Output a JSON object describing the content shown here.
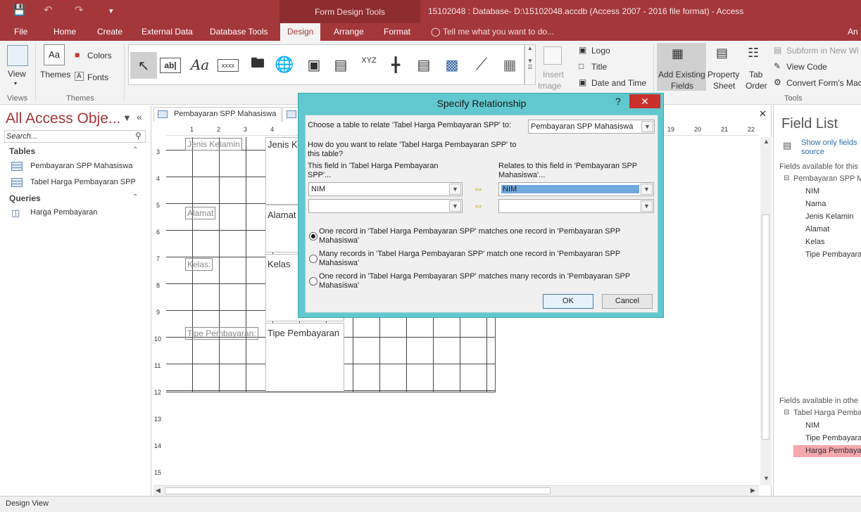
{
  "window": {
    "title": "15102048 : Database- D:\\15102048.accdb (Access 2007 - 2016 file format) - Access",
    "contextual_group": "Form Design Tools",
    "user_initials": "An"
  },
  "ribbon_tabs": [
    "File",
    "Home",
    "Create",
    "External Data",
    "Database Tools",
    "Design",
    "Arrange",
    "Format"
  ],
  "active_tab": "Design",
  "tell_me": "Tell me what you want to do...",
  "ribbon": {
    "views": {
      "view_label": "View",
      "group": "Views"
    },
    "themes": {
      "themes_label": "Themes",
      "colors_label": "Colors",
      "fonts_label": "Fonts",
      "group": "Themes"
    },
    "controls": [
      "ab|",
      "Aa",
      "xxxx",
      "XYZ"
    ],
    "header_footer": {
      "logo": "Logo",
      "title": "Title",
      "date_time": "Date and Time",
      "insert_image_1": "Insert",
      "insert_image_2": "Image"
    },
    "tools": {
      "add_existing_1": "Add Existing",
      "add_existing_2": "Fields",
      "property_1": "Property",
      "property_2": "Sheet",
      "tab_order_1": "Tab",
      "tab_order_2": "Order",
      "subform": "Subform in New Wi",
      "view_code": "View Code",
      "convert": "Convert Form's Mac",
      "group": "Tools"
    }
  },
  "nav_pane": {
    "title": "All Access Obje...",
    "search_placeholder": "Search...",
    "sections": [
      {
        "name": "Tables",
        "items": [
          "Pembayaran SPP Mahasiswa",
          "Tabel Harga Pembayaran SPP"
        ]
      },
      {
        "name": "Queries",
        "items": [
          "Harga Pembayaran"
        ]
      }
    ]
  },
  "doc_tabs": [
    "Pembayaran SPP Mahasiswa"
  ],
  "ruler_top": [
    "1",
    "2",
    "3",
    "4",
    "19",
    "20",
    "21",
    "22"
  ],
  "ruler_left": [
    "3",
    "4",
    "5",
    "6",
    "7",
    "8",
    "9",
    "10",
    "11",
    "12",
    "13",
    "14",
    "15"
  ],
  "form": {
    "labels": [
      "Jenis Kelamin",
      "Alamat",
      "Kelas:",
      "Tipe Pembayaran:"
    ],
    "textboxes": [
      "Jenis Ke",
      "Alamat",
      "Kelas",
      "Tipe Pembayaran"
    ]
  },
  "field_list": {
    "title": "Field List",
    "show_only_1": "Show only fields",
    "show_only_2": "source",
    "available_for": "Fields available for this",
    "table1": "Pembayaran SPP M",
    "table1_fields": [
      "NIM",
      "Nama",
      "Jenis Kelamin",
      "Alamat",
      "Kelas",
      "Tipe Pembayara"
    ],
    "available_other": "Fields available in othe",
    "table2": "Tabel Harga Pemba",
    "table2_fields": [
      "NIM",
      "Tipe Pembayara",
      "Harga Pembaya"
    ],
    "highlight_color": "#f4a7ad"
  },
  "status": "Design View",
  "dialog": {
    "title": "Specify Relationship",
    "help": "?",
    "prompt_choose": "Choose a table to relate 'Tabel Harga Pembayaran SPP' to:",
    "chosen_table": "Pembayaran SPP Mahasiswa",
    "prompt_how_1": "How do you want to relate 'Tabel Harga Pembayaran SPP' to",
    "prompt_how_2": "this table?",
    "this_field_1": "This field in 'Tabel Harga Pembayaran",
    "this_field_2": "SPP'...",
    "relates_to_1": "Relates to this field in 'Pembayaran SPP",
    "relates_to_2": "Mahasiswa'...",
    "left_field_1": "NIM",
    "left_field_2": "",
    "right_field_1": "NIM",
    "right_field_2": "",
    "options": [
      {
        "line1": "One record in 'Tabel Harga Pembayaran SPP' matches one record in 'Pembayaran SPP",
        "line2": "Mahasiswa'",
        "selected": true
      },
      {
        "line1": "Many records in 'Tabel Harga Pembayaran SPP' match one record in 'Pembayaran SPP",
        "line2": "Mahasiswa'",
        "selected": false
      },
      {
        "line1": "One record in 'Tabel Harga Pembayaran SPP' matches many records in 'Pembayaran SPP",
        "line2": "Mahasiswa'",
        "selected": false
      }
    ],
    "ok": "OK",
    "cancel": "Cancel"
  },
  "colors": {
    "accent": "#a4373a",
    "dialog_frame": "#61c8cf",
    "close": "#c9302c"
  }
}
